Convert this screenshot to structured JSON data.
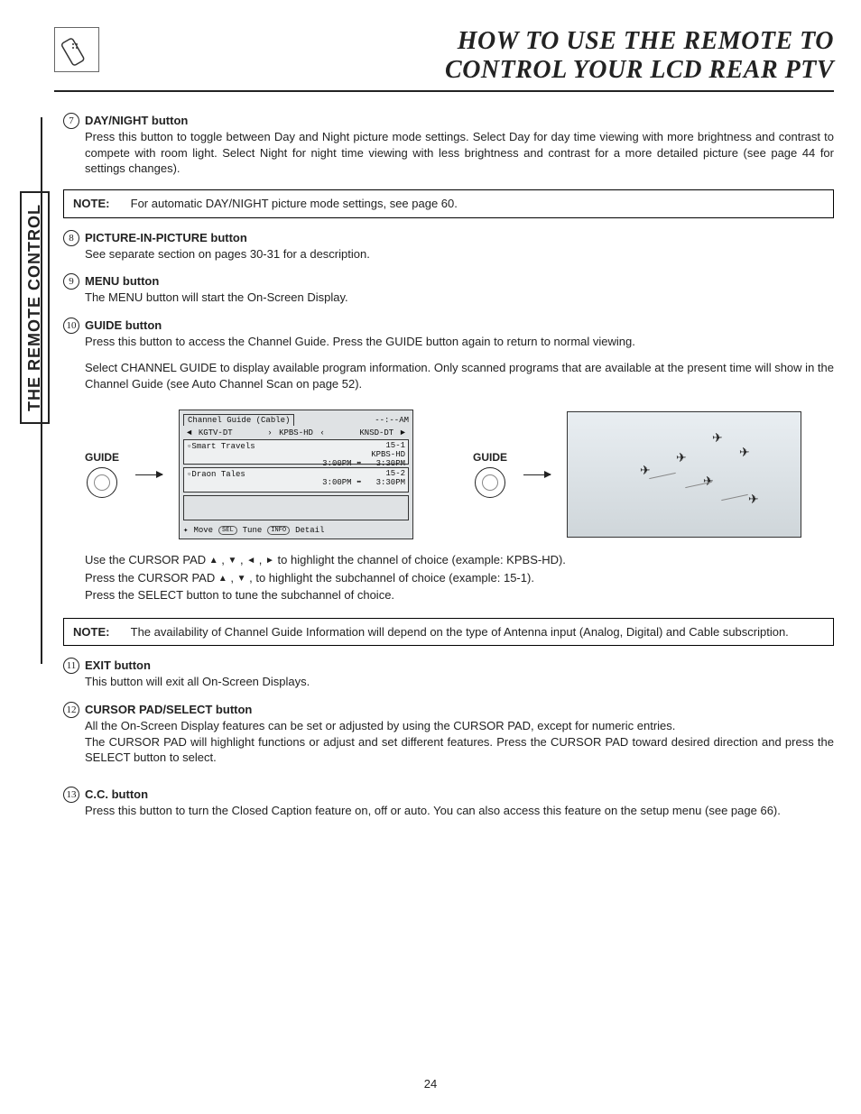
{
  "header": {
    "title_line1": "HOW TO USE THE REMOTE TO",
    "title_line2": "CONTROL YOUR LCD REAR PTV"
  },
  "side_tab": "THE REMOTE CONTROL",
  "items": {
    "7": {
      "num": "7",
      "heading": "DAY/NIGHT button",
      "text": "Press this button to toggle between Day and Night picture mode settings.  Select Day for day time viewing with more brightness and contrast to compete with room light.  Select Night for night time viewing with less brightness and contrast for a more detailed picture (see page 44 for settings changes)."
    },
    "8": {
      "num": "8",
      "heading": "PICTURE-IN-PICTURE button",
      "text": "See separate section on pages 30-31 for a description."
    },
    "9": {
      "num": "9",
      "heading": "MENU button",
      "text": "The MENU button will start the On-Screen Display."
    },
    "10": {
      "num": "10",
      "heading": "GUIDE button",
      "text1": "Press this button to access the Channel Guide.  Press the GUIDE button again to return to normal viewing.",
      "text2": "Select CHANNEL GUIDE to display available program information.  Only scanned programs that are available at the present time will show in the Channel Guide (see Auto Channel Scan on page 52)."
    },
    "11": {
      "num": "11",
      "heading": "EXIT button",
      "text": "This button will exit all On-Screen Displays."
    },
    "12": {
      "num": "12",
      "heading": "CURSOR PAD/SELECT button",
      "text": "All the On-Screen Display features can be set or adjusted by using the CURSOR PAD, except for numeric entries.\nThe CURSOR PAD will highlight functions or adjust and set different features.  Press the CURSOR PAD toward desired direction and press the SELECT button to select."
    },
    "13": {
      "num": "13",
      "heading": "C.C. button",
      "text": "Press this button to turn the Closed Caption feature on, off or auto.  You can also access this feature on the setup menu (see page 66)."
    }
  },
  "notes": {
    "n1": {
      "label": "NOTE:",
      "text": "For automatic DAY/NIGHT picture mode settings, see page 60."
    },
    "n2": {
      "label": "NOTE:",
      "text": "The availability of Channel Guide Information will depend on the type of Antenna input (Analog, Digital) and Cable subscription."
    }
  },
  "guide": {
    "button_label": "GUIDE",
    "cg_title": "Channel Guide (Cable)",
    "cg_time": "--:--AM",
    "ch_left": "KGTV-DT",
    "ch_mid": "KPBS-HD",
    "ch_right": "KNSD-DT",
    "row1_name": "Smart Travels",
    "row1_ch": "15-1",
    "row1_sub": "KPBS-HD",
    "row1_t1": "3:00PM",
    "row1_t2": "3:30PM",
    "row2_name": "Draon Tales",
    "row2_ch": "15-2",
    "row2_t1": "3:00PM",
    "row2_t2": "3:30PM",
    "bottom_move": "Move",
    "bottom_sel": "SEL",
    "bottom_tune": "Tune",
    "bottom_info": "INFO",
    "bottom_detail": "Detail"
  },
  "post_guide": {
    "l1a": "Use the CURSOR PAD ",
    "l1b": " to highlight the channel of choice (example: KPBS-HD).",
    "l2a": "Press  the CURSOR PAD ",
    "l2b": " , to highlight the subchannel of choice (example: 15-1).",
    "l3": "Press the SELECT button to tune the subchannel of choice."
  },
  "page_number": "24"
}
